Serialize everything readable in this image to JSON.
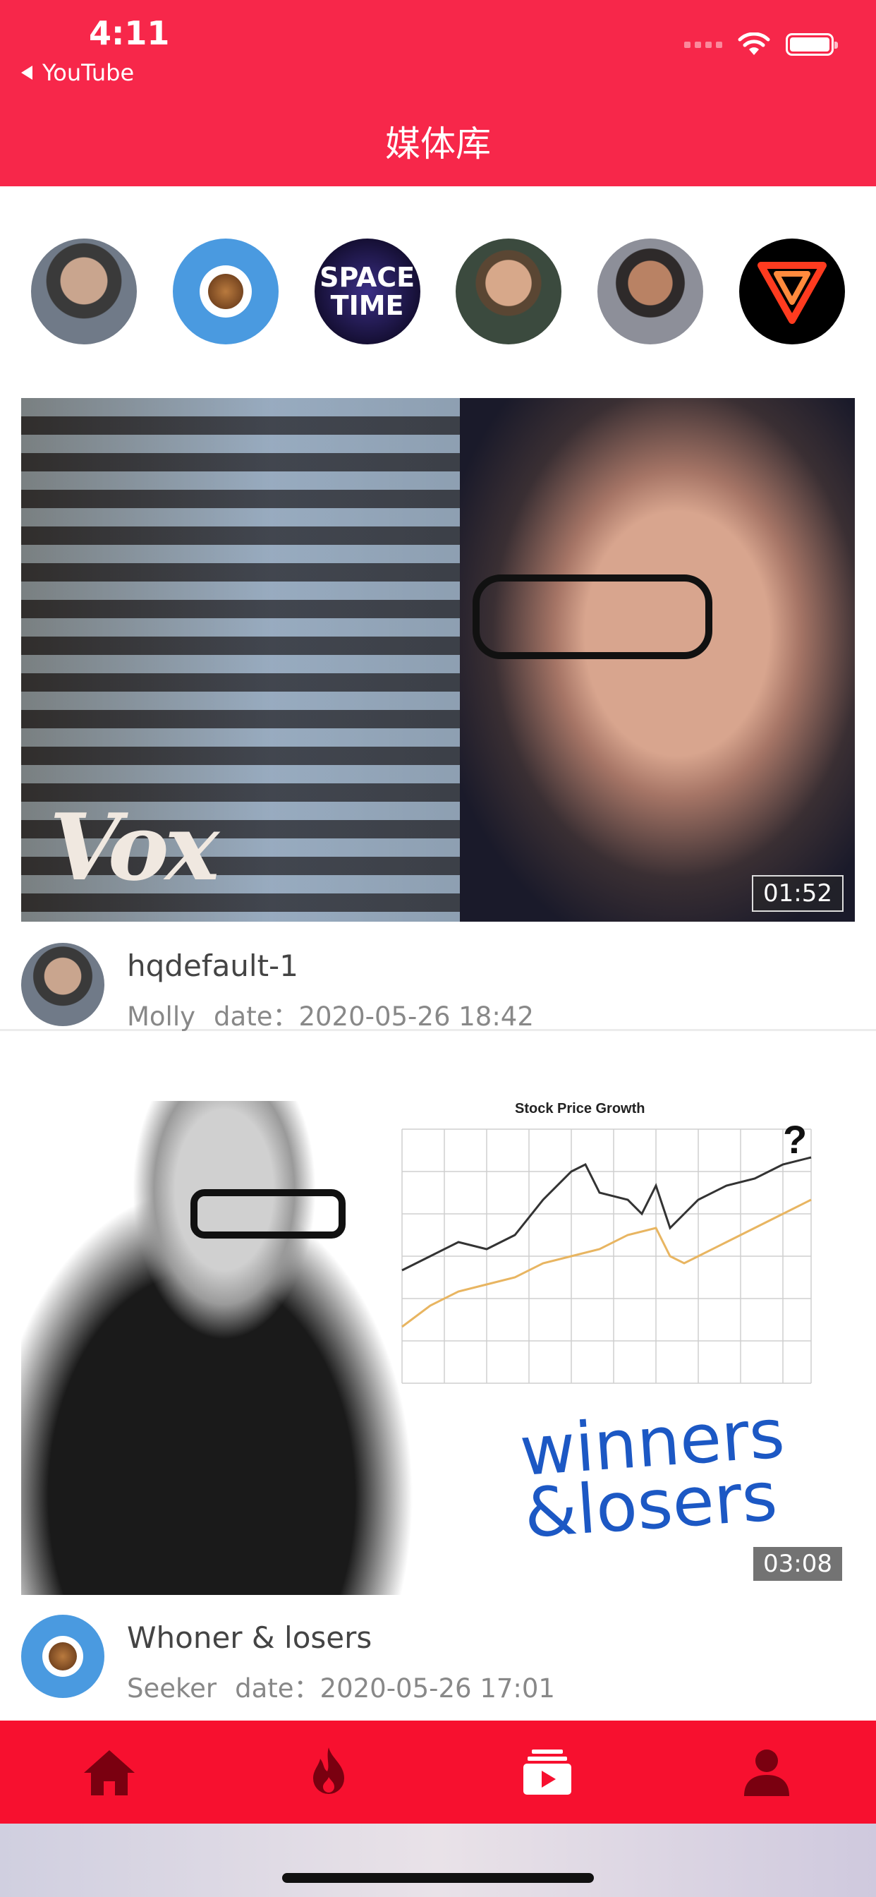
{
  "status_bar": {
    "time": "4:11",
    "back_label": "YouTube"
  },
  "header": {
    "title": "媒体库"
  },
  "channels": [
    {
      "name": "channel-avatar-1"
    },
    {
      "name": "channel-avatar-2"
    },
    {
      "name": "channel-avatar-3",
      "label_line1": "SPACE",
      "label_line2": "TIME"
    },
    {
      "name": "channel-avatar-4"
    },
    {
      "name": "channel-avatar-5"
    },
    {
      "name": "channel-avatar-6"
    }
  ],
  "videos": [
    {
      "title": "hqdefault-1",
      "author": "Molly",
      "date": "date：2020-05-26 18:42",
      "duration": "01:52",
      "thumb_text": "Vox"
    },
    {
      "title": "Whoner & losers",
      "author": "Seeker",
      "date": "date：2020-05-26 17:01",
      "duration": "03:08",
      "thumb_chart_title": "Stock Price Growth",
      "thumb_text_line1": "winners",
      "thumb_text_line2": "&losers",
      "thumb_mark": "?"
    }
  ],
  "tabbar": {
    "items": [
      {
        "icon": "home-icon",
        "active": false
      },
      {
        "icon": "fire-icon",
        "active": false
      },
      {
        "icon": "library-icon",
        "active": true
      },
      {
        "icon": "user-icon",
        "active": false
      }
    ],
    "active_color": "#ffffff",
    "inactive_color": "#7a0010"
  },
  "colors": {
    "brand": "#f7274a",
    "tabbar": "#f7102f"
  }
}
